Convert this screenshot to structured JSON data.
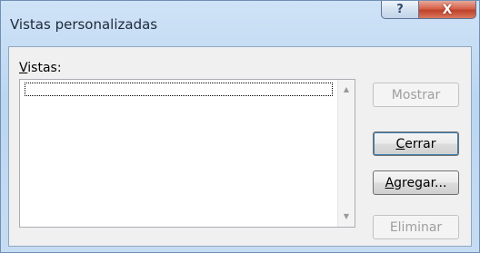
{
  "window": {
    "title": "Vistas personalizadas",
    "help_glyph": "?",
    "close_glyph": "X"
  },
  "views": {
    "label_mnemonic": "V",
    "label_rest": "istas:",
    "items": [],
    "scroll_up_glyph": "▲",
    "scroll_down_glyph": "▼"
  },
  "buttons": {
    "show": {
      "label": "Mostrar",
      "enabled": false
    },
    "close": {
      "mnemonic": "C",
      "label_rest": "errar",
      "enabled": true
    },
    "add": {
      "mnemonic": "A",
      "label_rest": "gregar...",
      "enabled": true
    },
    "delete": {
      "label": "Eliminar",
      "enabled": false
    }
  }
}
